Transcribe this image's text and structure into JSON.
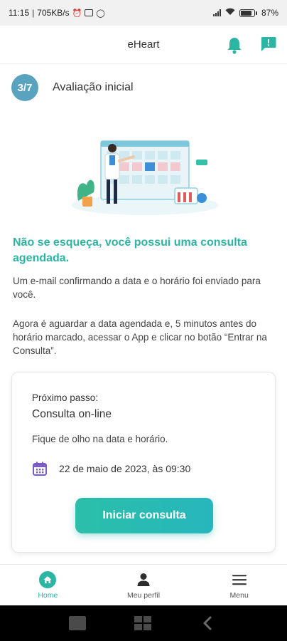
{
  "status_bar": {
    "time": "11:15",
    "network_speed": "705KB/s",
    "battery": "87"
  },
  "header": {
    "title": "eHeart",
    "icons": [
      "bell-icon",
      "message-icon"
    ]
  },
  "step": {
    "badge": "3/7",
    "title": "Avaliação inicial"
  },
  "message": {
    "headline": "Não se esqueça, você possui uma consulta agendada.",
    "paragraph1": "Um e-mail confirmando a data e o horário foi enviado para você.",
    "paragraph2": "Agora é aguardar a data agendada e, 5 minutos antes do horário marcado, acessar o App e clicar no botão “Entrar na Consulta”."
  },
  "card": {
    "label": "Próximo passo:",
    "title": "Consulta on-line",
    "description": "Fique de olho na data e horário.",
    "date": "22 de maio de 2023, às 09:30",
    "button": "Iniciar consulta"
  },
  "bottom_nav": {
    "items": [
      {
        "label": "Home",
        "icon": "home-icon",
        "active": true
      },
      {
        "label": "Meu perfil",
        "icon": "user-icon",
        "active": false
      },
      {
        "label": "Menu",
        "icon": "menu-icon",
        "active": false
      }
    ]
  },
  "colors": {
    "accent": "#2bb5a3",
    "step_badge": "#5aa3bf",
    "calendar_icon": "#7b5cc4"
  }
}
